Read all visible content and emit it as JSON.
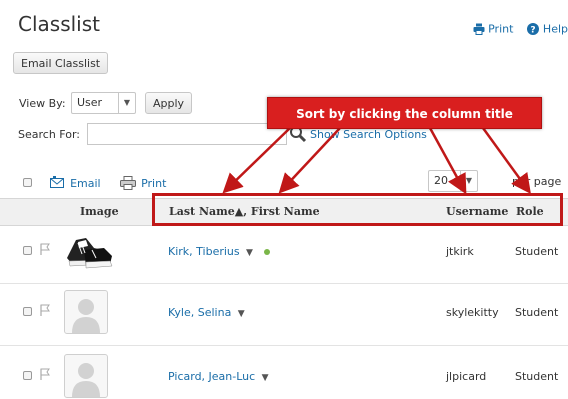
{
  "page": {
    "title": "Classlist",
    "print_label": "Print",
    "help_label": "Help"
  },
  "toolbar": {
    "email_classlist_label": "Email Classlist",
    "view_by_label": "View By:",
    "view_by_value": "User",
    "apply_label": "Apply",
    "search_for_label": "Search For:",
    "search_value": "",
    "show_search_options_label": "Show Search Options"
  },
  "actions": {
    "email_label": "Email",
    "print_label": "Print",
    "per_page_value": "20",
    "per_page_label": "per page"
  },
  "table": {
    "headers": {
      "image": "Image",
      "name": "Last Name▲, First Name",
      "username": "Username",
      "role": "Role"
    },
    "rows": [
      {
        "name": "Kirk, Tiberius",
        "username": "jtkirk",
        "role": "Student",
        "online": true,
        "avatar": "sneakers"
      },
      {
        "name": "Kyle, Selina",
        "username": "skylekitty",
        "role": "Student",
        "online": false,
        "avatar": "placeholder"
      },
      {
        "name": "Picard, Jean-Luc",
        "username": "jlpicard",
        "role": "Student",
        "online": false,
        "avatar": "placeholder"
      }
    ]
  },
  "annotation": {
    "callout_text": "Sort by clicking the column title",
    "accent_color": "#d91f1f"
  },
  "colors": {
    "link": "#1a6da8",
    "online_dot": "#7ab648"
  }
}
